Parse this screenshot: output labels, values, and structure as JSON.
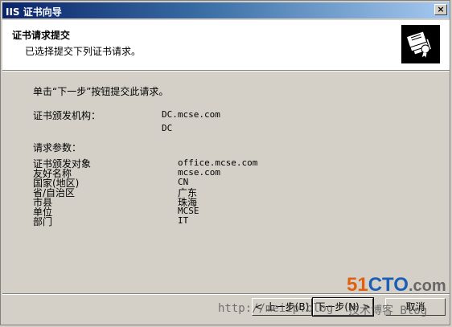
{
  "window": {
    "title": "IIS 证书向导",
    "close": "×"
  },
  "header": {
    "title": "证书请求提交",
    "subtitle": "已选择提交下列证书请求。",
    "icon": "certificate-icon"
  },
  "content": {
    "intro": "单击“下一步”按钮提交此请求。",
    "ca_label": "证书颁发机构：",
    "ca_value": "DC.mcse.com",
    "ca_value2": "DC",
    "params_label": "请求参数：",
    "params": [
      {
        "label": "证书颁发对象",
        "value": "office.mcse.com"
      },
      {
        "label": "友好名称",
        "value": "mcse.com"
      },
      {
        "label": "国家(地区)",
        "value": "CN"
      },
      {
        "label": "省/自治区",
        "value": "广东"
      },
      {
        "label": "市县",
        "value": "珠海"
      },
      {
        "label": "单位",
        "value": "MCSE"
      },
      {
        "label": "部门",
        "value": "IT"
      }
    ]
  },
  "buttons": {
    "back": "< 上一步(B)",
    "next": "下一步(N) >",
    "cancel": "取消"
  },
  "watermark": {
    "logo_51": "51",
    "logo_cto": "CTO",
    "logo_com": ".com",
    "url": "http://meiip.blog",
    "sub": "技术博客 Blog"
  },
  "colors": {
    "dialog_bg": "#d4d0c8",
    "title_start": "#0a246a",
    "title_end": "#a6caf0"
  }
}
